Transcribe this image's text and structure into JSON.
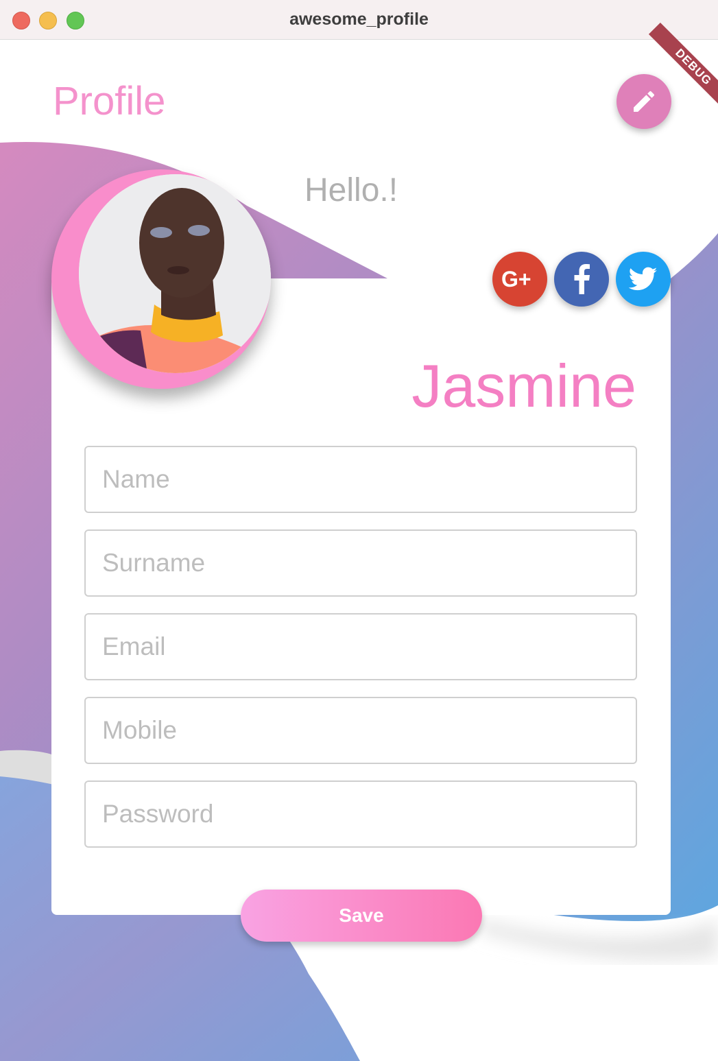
{
  "window": {
    "title": "awesome_profile"
  },
  "debug_banner": "DEBUG",
  "header": {
    "title": "Profile",
    "edit_icon": "pencil-icon"
  },
  "profile": {
    "greeting": "Hello.!",
    "name": "Jasmine",
    "avatar_icon": "user-avatar-photo"
  },
  "social": [
    {
      "name": "google-plus",
      "label": "G+",
      "color": "#d74432"
    },
    {
      "name": "facebook",
      "label": "f",
      "color": "#4366b3"
    },
    {
      "name": "twitter",
      "label": "twitter-bird",
      "color": "#1ea1f2"
    }
  ],
  "form": {
    "fields": [
      {
        "name": "name",
        "placeholder": "Name",
        "value": ""
      },
      {
        "name": "surname",
        "placeholder": "Surname",
        "value": ""
      },
      {
        "name": "email",
        "placeholder": "Email",
        "value": ""
      },
      {
        "name": "mobile",
        "placeholder": "Mobile",
        "value": ""
      },
      {
        "name": "password",
        "placeholder": "Password",
        "value": ""
      }
    ],
    "save_label": "Save"
  },
  "colors": {
    "accent_pink": "#f492cc",
    "fab_pink": "#df80b9",
    "gradient_start": "#d68cc0",
    "gradient_end": "#61a6de"
  }
}
